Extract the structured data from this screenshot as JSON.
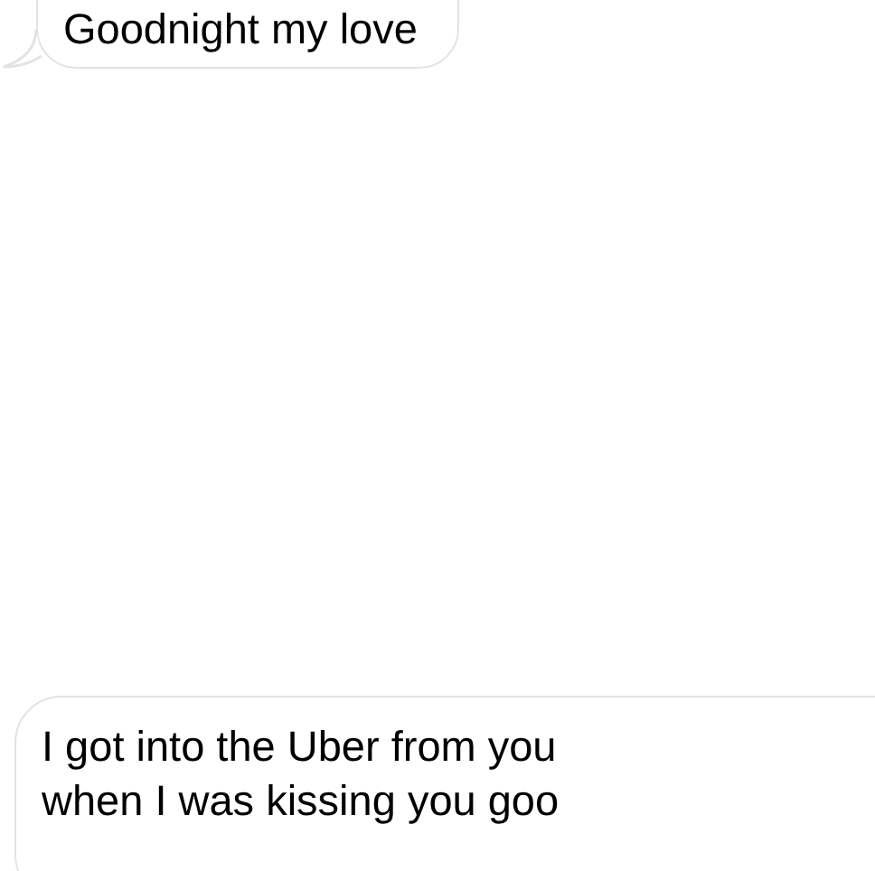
{
  "messages": [
    {
      "kind": "received",
      "text": "Goodnight my love"
    },
    {
      "kind": "received",
      "text": "I got into the Uber from you\nwhen I was kissing you goo"
    }
  ]
}
